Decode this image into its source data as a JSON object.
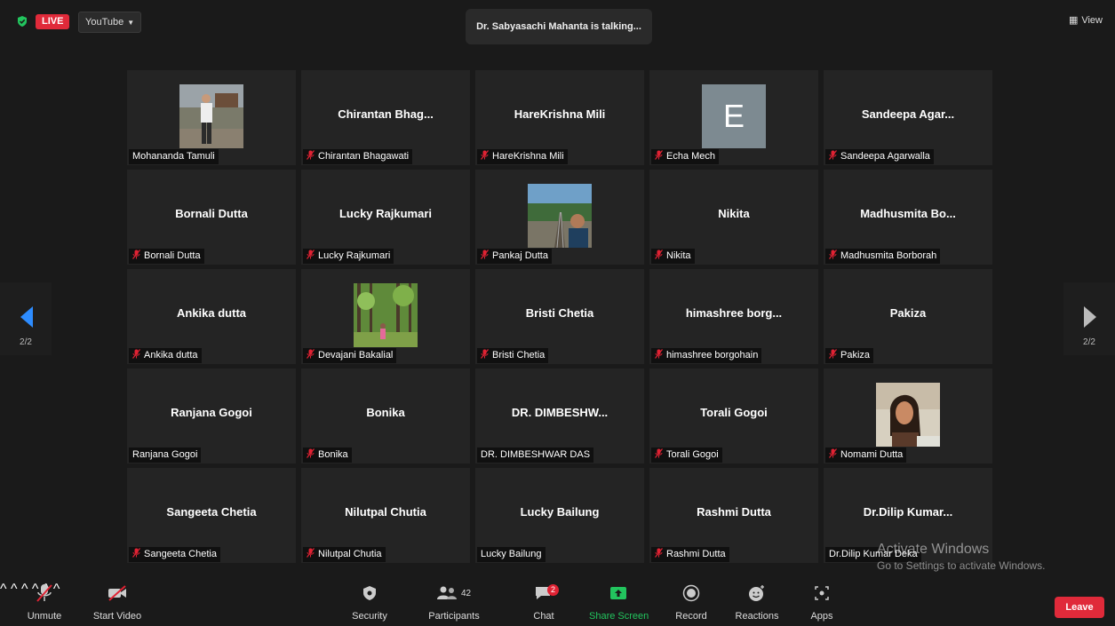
{
  "top_bar": {
    "live_label": "LIVE",
    "stream_target": "YouTube",
    "speaker_banner": "Dr. Sabyasachi Mahanta is talking...",
    "view_label": "View"
  },
  "tiles": [
    {
      "display": "",
      "name": "Mohananda Tamuli",
      "muted": false,
      "media": "photo-man"
    },
    {
      "display": "Chirantan  Bhag...",
      "name": "Chirantan Bhagawati",
      "muted": true
    },
    {
      "display": "HareKrishna Mili",
      "name": "HareKrishna Mili",
      "muted": true
    },
    {
      "display": "",
      "name": "Echa Mech",
      "muted": true,
      "media": "letter",
      "letter": "E"
    },
    {
      "display": "Sandeepa  Agar...",
      "name": "Sandeepa Agarwalla",
      "muted": true
    },
    {
      "display": "Bornali Dutta",
      "name": "Bornali Dutta",
      "muted": true
    },
    {
      "display": "Lucky Rajkumari",
      "name": "Lucky Rajkumari",
      "muted": true
    },
    {
      "display": "",
      "name": "Pankaj Dutta",
      "muted": true,
      "media": "photo-rail"
    },
    {
      "display": "Nikita",
      "name": "Nikita",
      "muted": true
    },
    {
      "display": "Madhusmita  Bo...",
      "name": "Madhusmita Borborah",
      "muted": true
    },
    {
      "display": "Ankika dutta",
      "name": "Ankika dutta",
      "muted": true
    },
    {
      "display": "",
      "name": "Devajani Bakalial",
      "muted": true,
      "media": "photo-forest"
    },
    {
      "display": "Bristi Chetia",
      "name": "Bristi Chetia",
      "muted": true
    },
    {
      "display": "himashree  borg...",
      "name": "himashree borgohain",
      "muted": true
    },
    {
      "display": "Pakiza",
      "name": "Pakiza",
      "muted": true
    },
    {
      "display": "Ranjana Gogoi",
      "name": "Ranjana Gogoi",
      "muted": false
    },
    {
      "display": "Bonika",
      "name": "Bonika",
      "muted": true
    },
    {
      "display": "DR.  DIMBESHW...",
      "name": "DR. DIMBESHWAR DAS",
      "muted": false
    },
    {
      "display": "Torali Gogoi",
      "name": "Torali Gogoi",
      "muted": true
    },
    {
      "display": "",
      "name": "Nomami Dutta",
      "muted": true,
      "media": "photo-woman"
    },
    {
      "display": "Sangeeta Chetia",
      "name": "Sangeeta Chetia",
      "muted": true
    },
    {
      "display": "Nilutpal Chutia",
      "name": "Nilutpal Chutia",
      "muted": true
    },
    {
      "display": "Lucky Bailung",
      "name": "Lucky Bailung",
      "muted": false
    },
    {
      "display": "Rashmi Dutta",
      "name": "Rashmi Dutta",
      "muted": true
    },
    {
      "display": "Dr.Dilip  Kumar...",
      "name": "Dr.Dilip Kumar Deka",
      "muted": false
    }
  ],
  "pagination": {
    "left_page": "2/2",
    "right_page": "2/2"
  },
  "watermark": {
    "line1": "Activate Windows",
    "line2": "Go to Settings to activate Windows."
  },
  "toolbar": {
    "unmute": "Unmute",
    "start_video": "Start Video",
    "security": "Security",
    "participants": "Participants",
    "participants_count": "42",
    "chat": "Chat",
    "chat_badge": "2",
    "share_screen": "Share Screen",
    "record": "Record",
    "reactions": "Reactions",
    "apps": "Apps",
    "leave": "Leave"
  },
  "colors": {
    "accent_blue": "#2d8cff",
    "leave_red": "#e02a3a",
    "share_green": "#22c55e",
    "muted_red": "#e02233"
  }
}
